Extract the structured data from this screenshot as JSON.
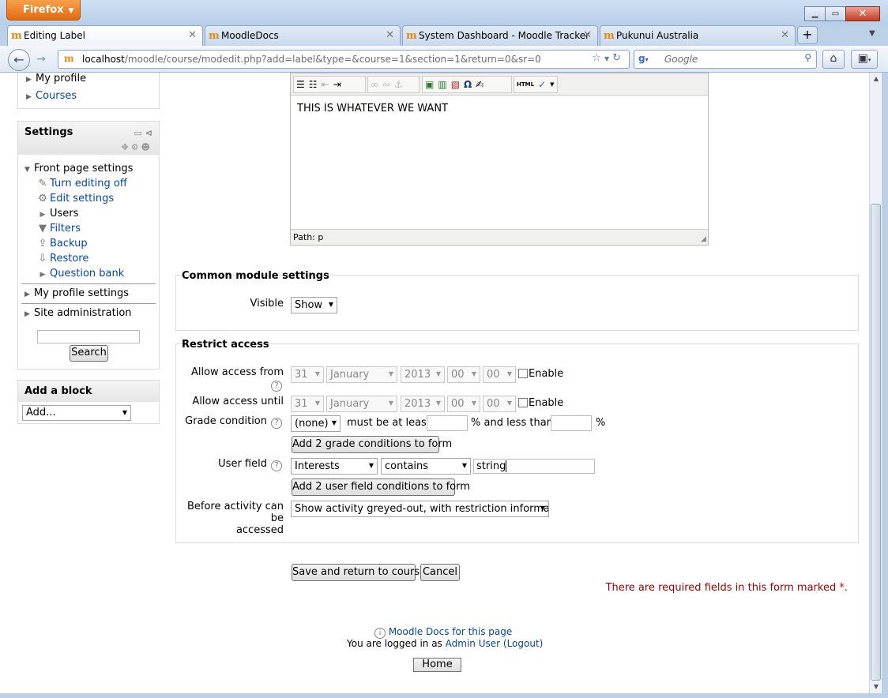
{
  "browser": {
    "app_button": "Firefox",
    "tabs": [
      {
        "title": "Editing Label"
      },
      {
        "title": "MoodleDocs"
      },
      {
        "title": "System Dashboard - Moodle Tracker"
      },
      {
        "title": "Pukunui Australia"
      }
    ],
    "url_host": "localhost",
    "url_path": "/moodle/course/modedit.php?add=label&type=&course=1&section=1&return=0&sr=0",
    "search_placeholder": "Google"
  },
  "navigation_block": {
    "items": [
      "My profile",
      "Courses"
    ]
  },
  "settings_block": {
    "title": "Settings",
    "front_page_settings": "Front page settings",
    "items": [
      {
        "label": "Turn editing off",
        "icon": "pencil-icon",
        "link": true
      },
      {
        "label": "Edit settings",
        "icon": "gear-icon",
        "link": true
      },
      {
        "label": "Users",
        "icon": "expand-arrow-icon",
        "link": false
      },
      {
        "label": "Filters",
        "icon": "funnel-icon",
        "link": true
      },
      {
        "label": "Backup",
        "icon": "backup-icon",
        "link": true
      },
      {
        "label": "Restore",
        "icon": "restore-icon",
        "link": true
      },
      {
        "label": "Question bank",
        "icon": "expand-arrow-icon",
        "link": true
      }
    ],
    "my_profile_settings": "My profile settings",
    "site_administration": "Site administration",
    "search_button": "Search"
  },
  "add_block": {
    "title": "Add a block",
    "select_value": "Add..."
  },
  "editor": {
    "content": "THIS IS WHATEVER WE WANT",
    "path": "Path: p",
    "html_button": "HTML"
  },
  "common_module": {
    "legend": "Common module settings",
    "visible_label": "Visible",
    "visible_value": "Show"
  },
  "restrict_access": {
    "legend": "Restrict access",
    "allow_from_label": "Allow access from",
    "allow_until_label": "Allow access until",
    "from": {
      "day": "31",
      "month": "January",
      "year": "2013",
      "hour": "00",
      "minute": "00",
      "enable": "Enable"
    },
    "until": {
      "day": "31",
      "month": "January",
      "year": "2013",
      "hour": "00",
      "minute": "00",
      "enable": "Enable"
    },
    "grade_condition_label": "Grade condition",
    "grade_value": "(none)",
    "must_be_at_least": "must be at least",
    "percent_and_less_than": "% and less than",
    "percent": "%",
    "add_grade_button": "Add 2 grade conditions to form",
    "user_field_label": "User field",
    "user_field_value": "Interests",
    "user_field_operator": "contains",
    "user_field_text": "string",
    "add_user_field_button": "Add 2 user field conditions to form",
    "before_activity_label_1": "Before activity can be",
    "before_activity_label_2": "accessed",
    "before_activity_value": "Show activity greyed-out, with restriction information"
  },
  "actions": {
    "save_return": "Save and return to course",
    "cancel": "Cancel",
    "required_note": "There are required fields in this form marked",
    "required_star": "*",
    "required_period": "."
  },
  "footer": {
    "docs_link": "Moodle Docs for this page",
    "logged_in_as": "You are logged in as",
    "user": "Admin User",
    "logout": "(Logout)",
    "home_button": "Home"
  },
  "colors": {
    "link": "#0645ad",
    "required_text": "#990000"
  }
}
